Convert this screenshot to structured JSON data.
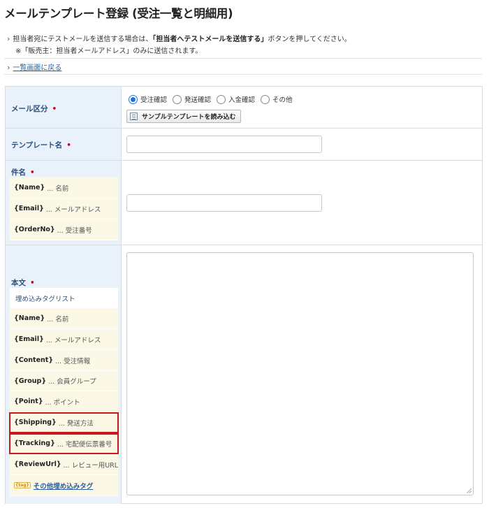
{
  "page_title": "メールテンプレート登録 (受注一覧と明細用)",
  "notes": {
    "line1_prefix": "担当者宛にテストメールを送信する場合は、",
    "line1_bold": "「担当者へテストメールを送信する」",
    "line1_suffix": "ボタンを押してください。",
    "line2": "※「販売主：担当者メールアドレス」のみに送信されます。"
  },
  "back_link": "一覧画面に戻る",
  "required_mark": "•",
  "form": {
    "mail_type": {
      "label": "メール区分",
      "options": [
        "受注確認",
        "発送確認",
        "入金確認",
        "その他"
      ],
      "selected": "受注確認",
      "sample_button": "サンプルテンプレートを読み込む"
    },
    "template_name": {
      "label": "テンプレート名",
      "value": ""
    },
    "subject": {
      "label": "件名",
      "value": "",
      "tags": [
        {
          "tag": "{Name}",
          "desc": "... 名前"
        },
        {
          "tag": "{Email}",
          "desc": "... メールアドレス"
        },
        {
          "tag": "{OrderNo}",
          "desc": "... 受注番号"
        }
      ]
    },
    "body": {
      "label": "本文",
      "tag_list_header": "埋め込みタグリスト",
      "value": "",
      "tags": [
        {
          "tag": "{Name}",
          "desc": "... 名前"
        },
        {
          "tag": "{Email}",
          "desc": "... メールアドレス"
        },
        {
          "tag": "{Content}",
          "desc": "... 受注情報"
        },
        {
          "tag": "{Group}",
          "desc": "... 会員グループ"
        },
        {
          "tag": "{Point}",
          "desc": "... ポイント"
        },
        {
          "tag": "{Shipping}",
          "desc": "... 発送方法"
        },
        {
          "tag": "{Tracking}",
          "desc": "... 宅配便伝票番号"
        },
        {
          "tag": "{ReviewUrl}",
          "desc": "... レビュー用URL"
        }
      ],
      "other_tags_badge": "{tag}",
      "other_tags_link": "その他埋め込みタグ"
    }
  },
  "colors": {
    "label_bg": "#e9f2fb",
    "tag_bg": "#fbf8e6",
    "required": "#d0021b",
    "highlight_border": "#c91a1a",
    "link": "#2b5f9e"
  }
}
